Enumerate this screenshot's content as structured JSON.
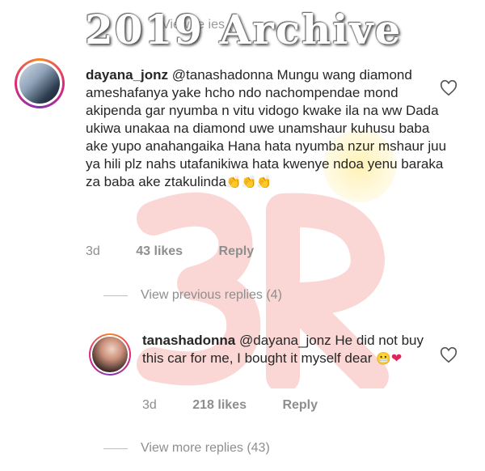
{
  "watermark": {
    "title": "2019 Archive",
    "faded_text": "View     re   ies (?"
  },
  "comments": [
    {
      "username": "dayana_jonz",
      "text": "@tanashadonna Mungu wang diamond ameshafanya yake hcho ndo nachompendae mond akipenda  gar nyumba n vitu vidogo kwake ila na ww Dada ukiwa unakaa na diamond uwe unamshaur kuhusu baba ake yupo anahangaika Hana hata nyumba nzur mshaur juu ya hili plz nahs utafanikiwa hata kwenye ndoa yenu baraka za baba ake ztakulinda",
      "emoji": "👏👏👏",
      "time": "3d",
      "likes": "43 likes",
      "reply_label": "Reply",
      "view_replies": "View previous replies (4)",
      "like_icon": "heart-outline-icon"
    },
    {
      "username": "tanashadonna",
      "text": "@dayana_jonz He did not buy this car for me, I bought it myself dear",
      "emoji": "😬",
      "emoji2": "❤",
      "time": "3d",
      "likes": "218 likes",
      "reply_label": "Reply",
      "view_replies": "View more replies (43)",
      "like_icon": "heart-outline-icon"
    }
  ],
  "colors": {
    "text": "#262626",
    "muted": "#8e8e8e",
    "watermark_red": "#e8473f"
  }
}
